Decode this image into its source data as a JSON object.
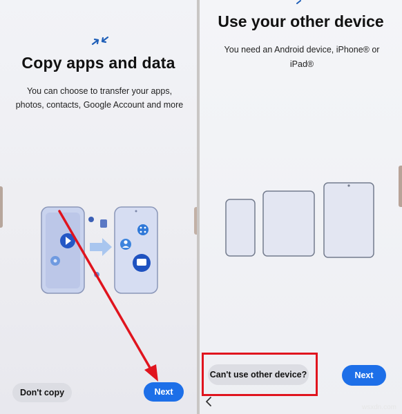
{
  "left_screen": {
    "title": "Copy apps and data",
    "subtitle": "You can choose to transfer your apps, photos, contacts, Google Account and more",
    "dont_copy_label": "Don't copy",
    "next_label": "Next"
  },
  "right_screen": {
    "title": "Use your other device",
    "subtitle": "You need an Android device, iPhone® or iPad®",
    "cant_use_label": "Can't use other device?",
    "next_label": "Next"
  },
  "watermark": "wsxdn.com",
  "colors": {
    "accent": "#1d6fe8",
    "highlight_red": "#e0141e",
    "device_fill": "#e3e6f2"
  },
  "icons": {
    "transfer": "transfer-arrows-icon",
    "back": "back-chevron-icon"
  }
}
